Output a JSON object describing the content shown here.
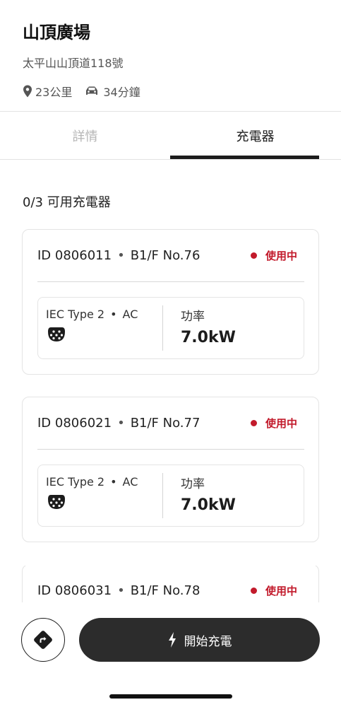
{
  "station": {
    "name": "山頂廣場",
    "address": "太平山山頂道118號",
    "distance": "23公里",
    "duration": "34分鐘"
  },
  "tabs": [
    {
      "label": "詳情",
      "active": false
    },
    {
      "label": "充電器",
      "active": true
    }
  ],
  "availability": "0/3 可用充電器",
  "chargers": [
    {
      "id": "ID 0806011",
      "location": "B1/F No.76",
      "status": "使用中",
      "connector": "IEC Type 2",
      "current": "AC",
      "power_label": "功率",
      "power": "7.0kW"
    },
    {
      "id": "ID 0806021",
      "location": "B1/F No.77",
      "status": "使用中",
      "connector": "IEC Type 2",
      "current": "AC",
      "power_label": "功率",
      "power": "7.0kW"
    },
    {
      "id": "ID 0806031",
      "location": "B1/F No.78",
      "status": "使用中"
    }
  ],
  "separator": "•",
  "actions": {
    "start_charging": "開始充電",
    "navigate_icon": "navigation-turn-icon",
    "start_icon": "lightning-bolt-icon"
  },
  "colors": {
    "status_busy": "#c21a2b",
    "button_dark": "#2c2c2c",
    "inactive_tab": "#b5b5b5"
  }
}
